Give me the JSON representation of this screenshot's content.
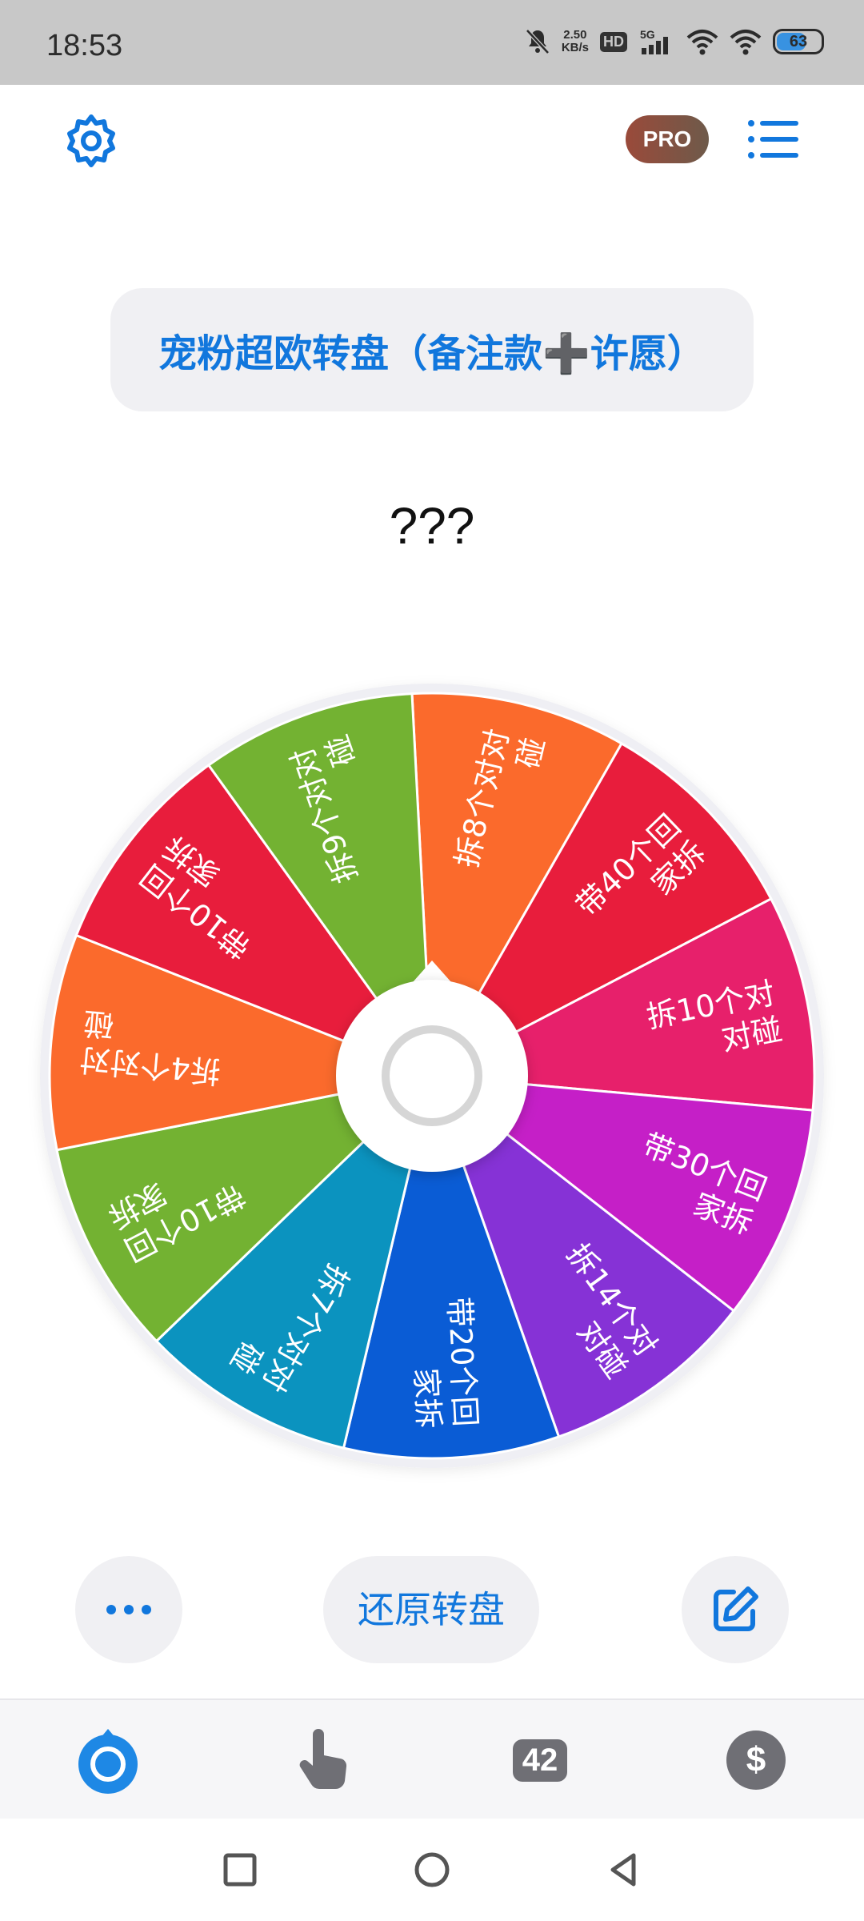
{
  "status_bar": {
    "time": "18:53",
    "net_speed_value": "2.50",
    "net_speed_unit": "KB/s",
    "hd_label": "HD",
    "signal_label": "5G",
    "battery": "63"
  },
  "header": {
    "pro_label": "PRO"
  },
  "wheel": {
    "title": "宠粉超欧转盘（备注款➕许愿）",
    "result": "???",
    "segments": [
      {
        "label": [
          "拆8个对对",
          "碰"
        ],
        "color": "#fb6a2c"
      },
      {
        "label": [
          "带40个回",
          "家拆"
        ],
        "color": "#e81d3c"
      },
      {
        "label": [
          "拆10个对",
          "对碰"
        ],
        "color": "#e7206b"
      },
      {
        "label": [
          "带30个回",
          "家拆"
        ],
        "color": "#c51fc7"
      },
      {
        "label": [
          "拆14个对",
          "对碰"
        ],
        "color": "#8632d6"
      },
      {
        "label": [
          "带20个回",
          "家拆"
        ],
        "color": "#0a5cd5"
      },
      {
        "label": [
          "拆7个对对",
          "碰"
        ],
        "color": "#0b93bf"
      },
      {
        "label": [
          "带10个回",
          "家拆"
        ],
        "color": "#73b232"
      },
      {
        "label": [
          "拆4个对对",
          "碰"
        ],
        "color": "#fb6a2c"
      },
      {
        "label": [
          "带10个回",
          "家拆"
        ],
        "color": "#e81d3c"
      },
      {
        "label": [
          "拆9个对对",
          "碰"
        ],
        "color": "#73b232"
      }
    ]
  },
  "actions": {
    "reset_label": "还原转盘"
  },
  "tabbar": {
    "count_badge": "42"
  },
  "colors": {
    "accent": "#1177dd",
    "tab_active": "#1e88e5",
    "tab_inactive": "#6f6f75"
  }
}
